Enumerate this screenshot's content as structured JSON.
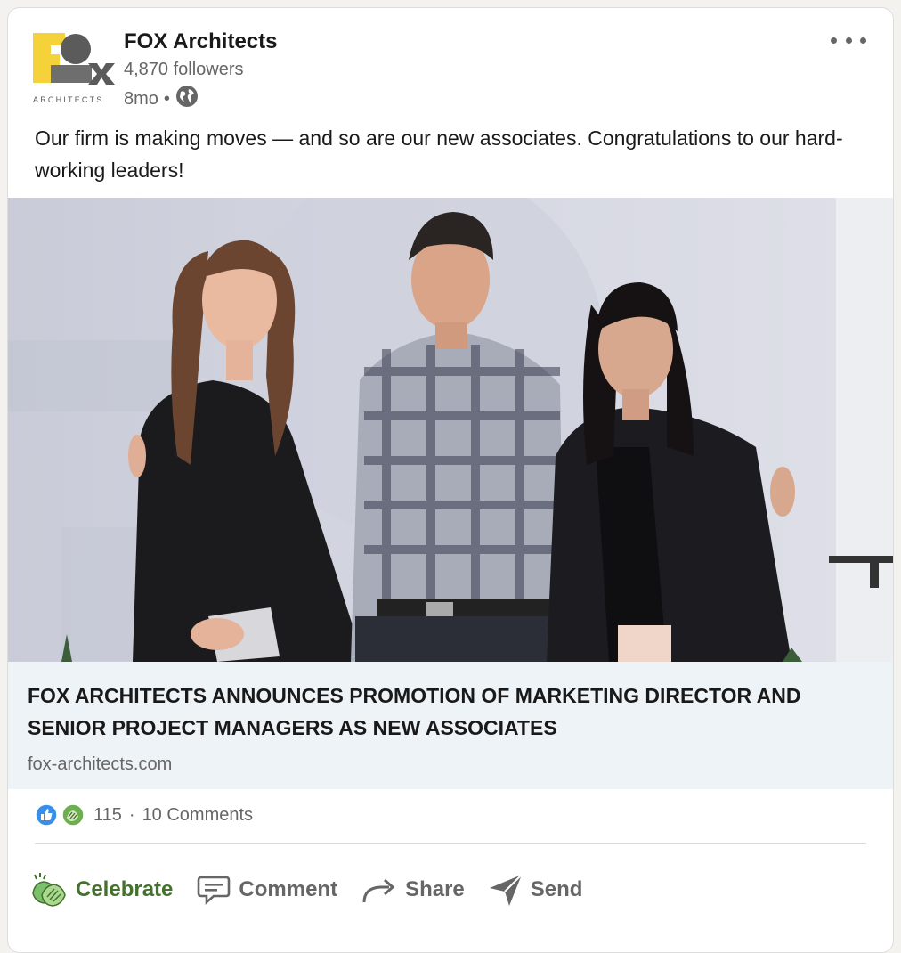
{
  "post": {
    "company_name": "FOX Architects",
    "followers": "4,870 followers",
    "age": "8mo",
    "meta_separator": "•",
    "visibility_icon": "globe-icon",
    "more_icon": "more-options-icon",
    "text": "Our firm is making moves — and so are our new associates. Congratulations to our hard-working leaders!"
  },
  "logo": {
    "letters": "FOX",
    "subtitle": "ARCHITECTS",
    "colors": {
      "yellow": "#f6d23a",
      "gray": "#5b5b5b"
    }
  },
  "photo": {
    "description_icon": "team-photo"
  },
  "link": {
    "title": "FOX ARCHITECTS ANNOUNCES PROMOTION OF MARKETING DIRECTOR AND SENIOR PROJECT MANAGERS AS NEW ASSOCIATES",
    "domain": "fox-architects.com"
  },
  "social": {
    "reaction_count": "115",
    "separator": "·",
    "comments": "10 Comments",
    "reaction_icons": [
      "like-icon",
      "celebrate-icon"
    ]
  },
  "actions": {
    "celebrate": "Celebrate",
    "comment": "Comment",
    "share": "Share",
    "send": "Send"
  },
  "colors": {
    "celebrate_green": "#44712e",
    "link_box_bg": "#eef3f8",
    "like_blue": "#378fe9"
  }
}
